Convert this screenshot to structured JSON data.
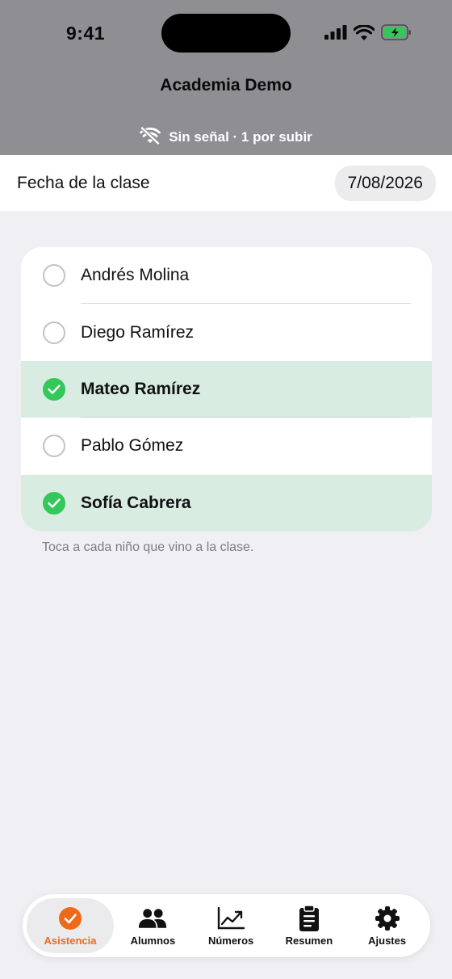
{
  "status_bar": {
    "time": "9:41"
  },
  "header": {
    "title": "Academia Demo"
  },
  "offline_banner": {
    "text": "Sin señal · 1 por subir",
    "icon": "wifi-off-icon"
  },
  "date_row": {
    "label": "Fecha de la clase",
    "value": "7/08/2026"
  },
  "students": [
    {
      "name": "Andrés Molina",
      "present": false
    },
    {
      "name": "Diego Ramírez",
      "present": false
    },
    {
      "name": "Mateo Ramírez",
      "present": true
    },
    {
      "name": "Pablo Gómez",
      "present": false
    },
    {
      "name": "Sofía Cabrera",
      "present": true
    }
  ],
  "hint": "Toca a cada niño que vino a la clase.",
  "tabs": [
    {
      "label": "Asistencia",
      "icon": "attendance-check-icon",
      "active": true
    },
    {
      "label": "Alumnos",
      "icon": "people-icon",
      "active": false
    },
    {
      "label": "Números",
      "icon": "chart-line-icon",
      "active": false
    },
    {
      "label": "Resumen",
      "icon": "clipboard-icon",
      "active": false
    },
    {
      "label": "Ajustes",
      "icon": "gear-icon",
      "active": false
    }
  ],
  "colors": {
    "header_bg": "#8e8e93",
    "present_row_bg": "#d9ece2",
    "check_green": "#34c759",
    "accent_orange": "#ee6a1a",
    "battery_green": "#34c759"
  }
}
